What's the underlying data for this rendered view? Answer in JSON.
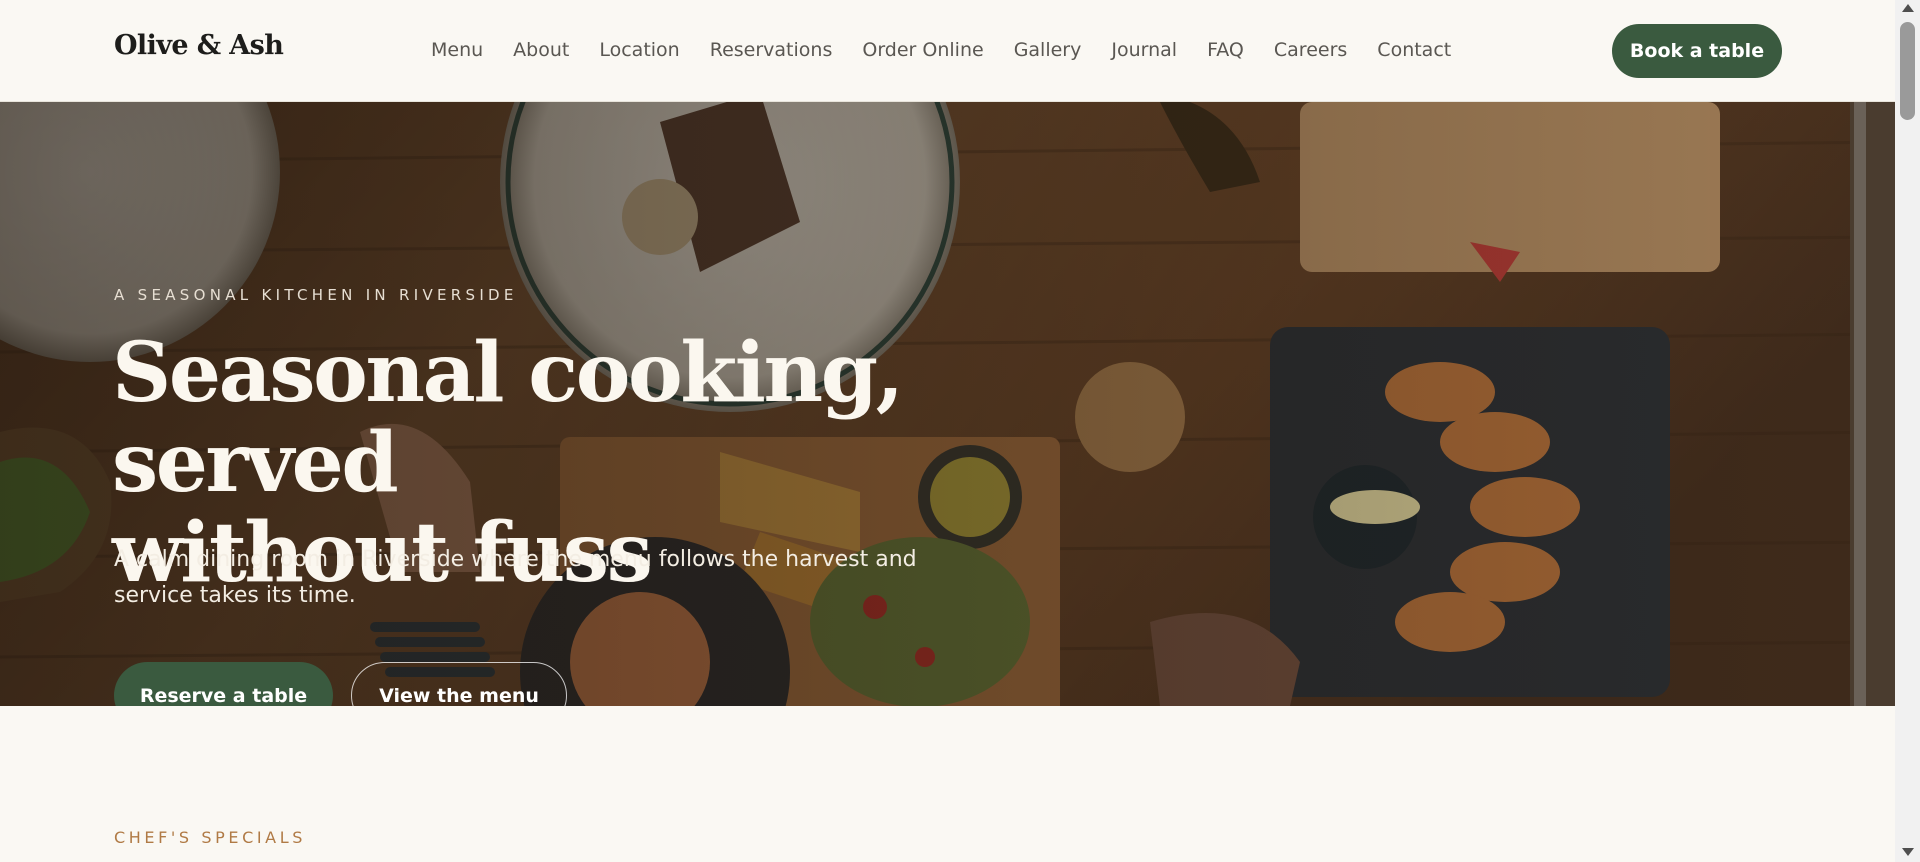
{
  "brand": {
    "name": "Olive & Ash"
  },
  "nav": {
    "items": [
      {
        "label": "Menu"
      },
      {
        "label": "About"
      },
      {
        "label": "Location"
      },
      {
        "label": "Reservations"
      },
      {
        "label": "Order Online"
      },
      {
        "label": "Gallery"
      },
      {
        "label": "Journal"
      },
      {
        "label": "FAQ"
      },
      {
        "label": "Careers"
      },
      {
        "label": "Contact"
      }
    ],
    "cta_label": "Book a table"
  },
  "hero": {
    "eyebrow": "A SEASONAL KITCHEN IN RIVERSIDE",
    "title_line1": "Seasonal cooking, served",
    "title_line2": "without fuss",
    "subtitle": "A calm dining room in Riverside where the menu follows the harvest and service takes its time.",
    "primary_cta": "Reserve a table",
    "secondary_cta": "View the menu",
    "image_description": "overhead-table-spread"
  },
  "specials": {
    "label": "CHEF'S SPECIALS"
  },
  "colors": {
    "accent_green": "#3a5a3f",
    "background": "#faf8f3",
    "section_label": "#b07a45"
  }
}
